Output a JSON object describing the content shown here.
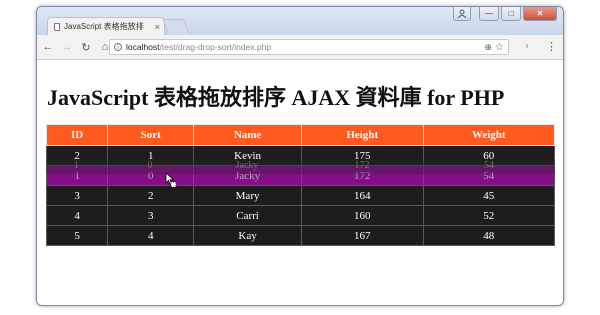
{
  "browser": {
    "tab_title": "JavaScript 表格拖放排序",
    "tab_close": "×",
    "url_host": "localhost",
    "url_path": "/test/drag-drop-sort/index.php",
    "controls": {
      "minimize": "—",
      "maximize": "□",
      "close": "✕"
    }
  },
  "page": {
    "title": "JavaScript 表格拖放排序 AJAX 資料庫 for PHP"
  },
  "table": {
    "headers": [
      "ID",
      "Sort",
      "Name",
      "Height",
      "Weight"
    ],
    "rows": [
      [
        "2",
        "1",
        "Kevin",
        "175",
        "60"
      ],
      [
        "1",
        "0",
        "Jacky",
        "172",
        "54"
      ],
      [
        "3",
        "2",
        "Mary",
        "164",
        "45"
      ],
      [
        "4",
        "3",
        "Carri",
        "160",
        "52"
      ],
      [
        "5",
        "4",
        "Kay",
        "167",
        "48"
      ]
    ],
    "ghost_row": [
      "1",
      "0",
      "Jacky",
      "172",
      "54"
    ]
  },
  "colors": {
    "header_bg": "#ff5a1f",
    "row_bg": "#1d1d1d",
    "dragging_row_bg": "#840e88"
  }
}
